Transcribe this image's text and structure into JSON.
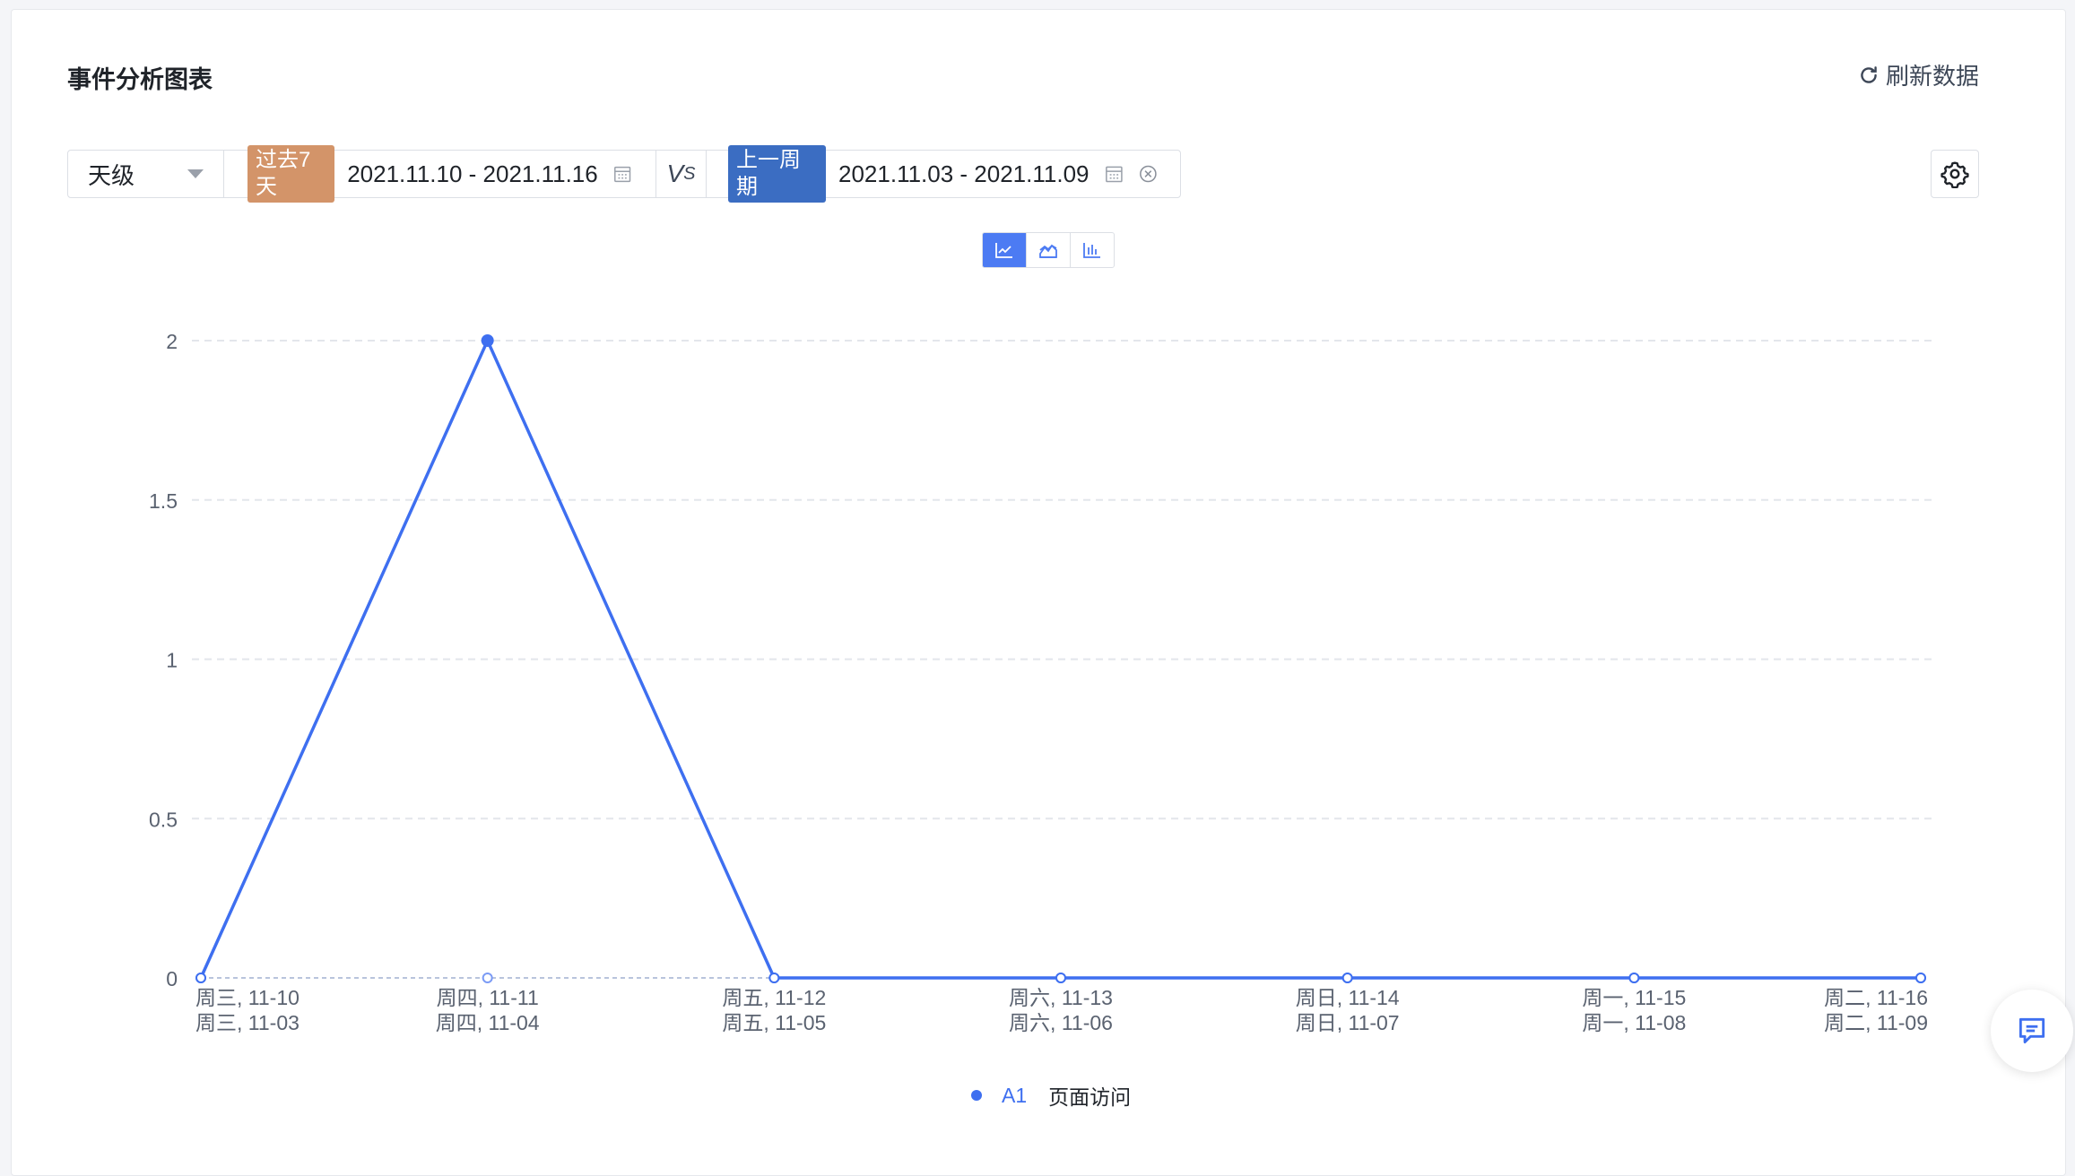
{
  "header": {
    "title": "事件分析图表",
    "refresh_label": "刷新数据"
  },
  "filters": {
    "granularity": "天级",
    "current_tag": "过去7天",
    "current_range": "2021.11.10 - 2021.11.16",
    "vs_label": "V",
    "vs_sub": "S",
    "compare_tag": "上一周期",
    "compare_range": "2021.11.03 - 2021.11.09"
  },
  "chart_switch": {
    "options": [
      "line-chart-icon",
      "area-chart-icon",
      "bar-chart-icon"
    ],
    "active": "line-chart-icon"
  },
  "colors": {
    "series": "#3e6ff0",
    "compare_series": "#7b9bf5",
    "grid": "#e3e6eb",
    "tag_current": "#d39469",
    "tag_compare": "#3b6dc2"
  },
  "chart_data": {
    "type": "line",
    "title": "",
    "xlabel": "",
    "ylabel": "",
    "ylim": [
      0,
      2
    ],
    "yticks": [
      "0",
      "0.5",
      "1",
      "1.5",
      "2"
    ],
    "categories": [
      [
        "周三, 11-10",
        "周三, 11-03"
      ],
      [
        "周四, 11-11",
        "周四, 11-04"
      ],
      [
        "周五, 11-12",
        "周五, 11-05"
      ],
      [
        "周六, 11-13",
        "周六, 11-06"
      ],
      [
        "周日, 11-14",
        "周日, 11-07"
      ],
      [
        "周一, 11-15",
        "周一, 11-08"
      ],
      [
        "周二, 11-16",
        "周二, 11-09"
      ]
    ],
    "grid": true,
    "legend_position": "bottom-center",
    "series": [
      {
        "name": "A1 页面访问",
        "code": "A1",
        "label": "页面访问",
        "period": "current",
        "values": [
          0,
          2,
          0,
          0,
          0,
          0,
          0
        ]
      },
      {
        "period": "compare",
        "values": [
          0,
          0,
          0,
          0,
          0,
          0,
          0
        ]
      }
    ]
  }
}
